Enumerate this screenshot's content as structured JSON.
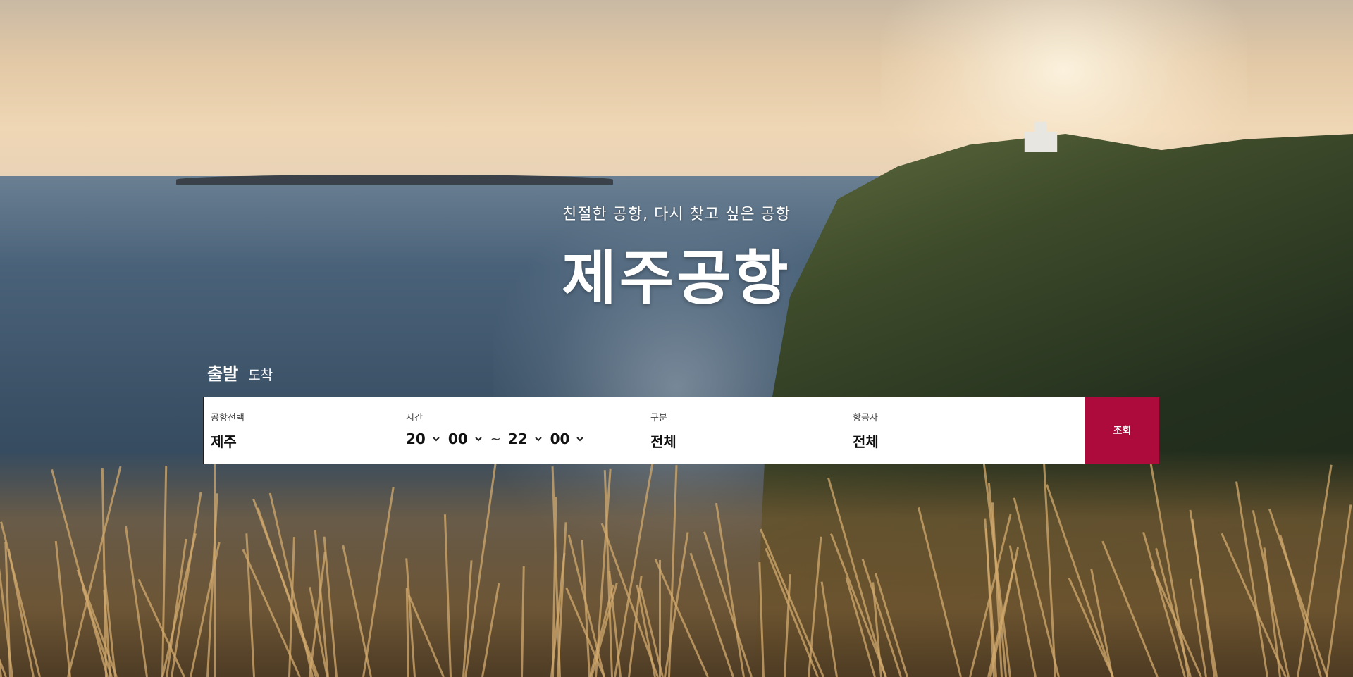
{
  "header": {
    "subtitle": "친절한 공항, 다시 찾고 싶은 공항",
    "title": "제주공항"
  },
  "tabs": [
    {
      "label": "출발",
      "active": true
    },
    {
      "label": "도착",
      "active": false
    }
  ],
  "search": {
    "airport": {
      "label": "공항선택",
      "value": "제주"
    },
    "time": {
      "label": "시간",
      "start_hour": "20",
      "start_minute": "00",
      "separator": "~",
      "end_hour": "22",
      "end_minute": "00"
    },
    "type": {
      "label": "구분",
      "value": "전체"
    },
    "airline": {
      "label": "항공사",
      "value": "전체"
    },
    "button_label": "조회"
  },
  "icons": {
    "dropdown": "chevron-down-icon"
  },
  "colors": {
    "button_bg": "#ad0b3c",
    "text_white": "#ffffff"
  }
}
